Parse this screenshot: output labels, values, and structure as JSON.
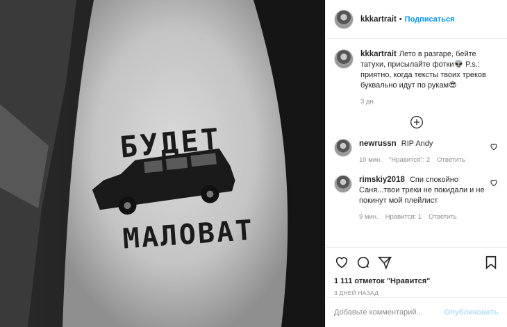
{
  "post": {
    "username": "kkkartrait",
    "follow_label": "Подписаться",
    "dot": "•"
  },
  "caption": {
    "username": "kkkartrait",
    "text": "Лето в разгаре, бейте татухи, присылайте фотки",
    "text2": " P.s.: приятно, когда тексты твоих треков буквально идут по рукам",
    "time": "3 дн."
  },
  "tattoo_text": {
    "top": "БУДЕТ",
    "bottom": "МАЛОВАТ"
  },
  "comments": [
    {
      "username": "newrussn",
      "text": "RIP Andy",
      "time": "10 мин.",
      "likes": "\"Нравится\": 2",
      "reply": "Ответить"
    },
    {
      "username": "rimskiy2018",
      "text": "Спи спокойно Саня...твои треки не покидали и не покинут мой плейлист",
      "time": "9 мин.",
      "likes": "Нравится: 1",
      "reply": "Ответить"
    }
  ],
  "stats": {
    "likes": "1 111 отметок \"Нравится\"",
    "ago": "3 ДНЕЙ НАЗАД"
  },
  "add_comment": {
    "placeholder": "Добавьте комментарий...",
    "publish": "Опубликовать"
  },
  "icons": [
    "heart-icon",
    "comment-icon",
    "share-icon",
    "bookmark-icon",
    "plus-circle-icon"
  ]
}
